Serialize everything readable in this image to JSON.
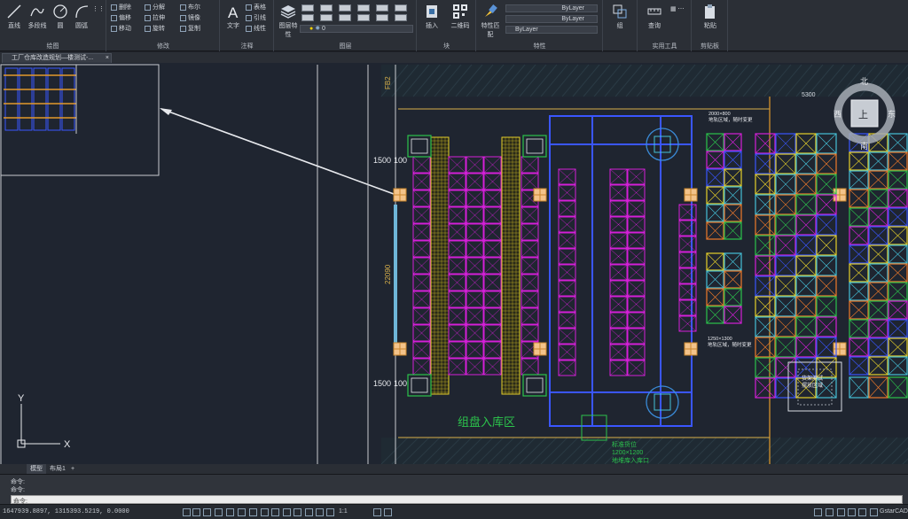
{
  "ribbon": {
    "groups": [
      {
        "title": "绘图",
        "tools": [
          "直线",
          "多段线",
          "圆",
          "圆弧"
        ]
      },
      {
        "title": "修改",
        "tools": [
          "删除",
          "分解",
          "布尔",
          "偏移",
          "拉伸",
          "镜像",
          "移动",
          "旋转",
          "复制"
        ]
      },
      {
        "title": "注释",
        "tools": [
          "文字",
          "表格",
          "引线",
          "线性"
        ]
      },
      {
        "title": "图层",
        "tools": [
          "图层特性"
        ],
        "layer_value": "0"
      },
      {
        "title": "块",
        "tools": [
          "插入",
          "二维码"
        ]
      },
      {
        "title": "特性",
        "tools": [
          "特性匹配"
        ],
        "bylayer": [
          "ByLayer",
          "ByLayer",
          "ByLayer"
        ]
      },
      {
        "title": "",
        "tools": [
          "组"
        ]
      },
      {
        "title": "实用工具",
        "tools": [
          "查询"
        ]
      },
      {
        "title": "剪贴板",
        "tools": [
          "粘贴"
        ]
      }
    ]
  },
  "document": {
    "tab_title": "工厂仓库改造规划—楼测试-..."
  },
  "canvas": {
    "labels": {
      "zone_main": "组盘入库区",
      "dim_top": "5300",
      "dim_1500_a": "1500",
      "dim_100_a": "100",
      "dim_1500_b": "1500",
      "dim_100_b": "100",
      "dim_vertical_a": "FB2",
      "dim_vertical_b": "22090",
      "rack_note_top": "2000×800",
      "rack_note_top2": "地轨区域，随时变更",
      "rack_note_mid": "1250×1300",
      "rack_note_mid2": "地轨区域，随时变更",
      "green_note_1": "标准货位",
      "green_note_2": "1200×1200",
      "green_note_3": "地堆库入库口",
      "box_note_1": "货架测试",
      "box_note_2": "摆放区域",
      "axis_y": "Y",
      "axis_x": "X"
    },
    "viewcube": {
      "north": "北",
      "south": "南",
      "west": "西",
      "east": "东",
      "top": "上"
    }
  },
  "layout_tabs": [
    "模型",
    "布局1",
    "+"
  ],
  "command": {
    "lines": [
      "命令:",
      "命令:"
    ],
    "prompt": "命令:"
  },
  "status": {
    "coords": "1647939.8897, 1315393.5219, 0.0000",
    "scale": "1:1",
    "app": "GstarCAD"
  },
  "colors": {
    "accent": "#2d6fb4",
    "rack_magenta": "#d41fd8",
    "rack_blue": "#3a56ff",
    "rack_yellow": "#e6d02a",
    "grid_green": "#2cc44c"
  }
}
